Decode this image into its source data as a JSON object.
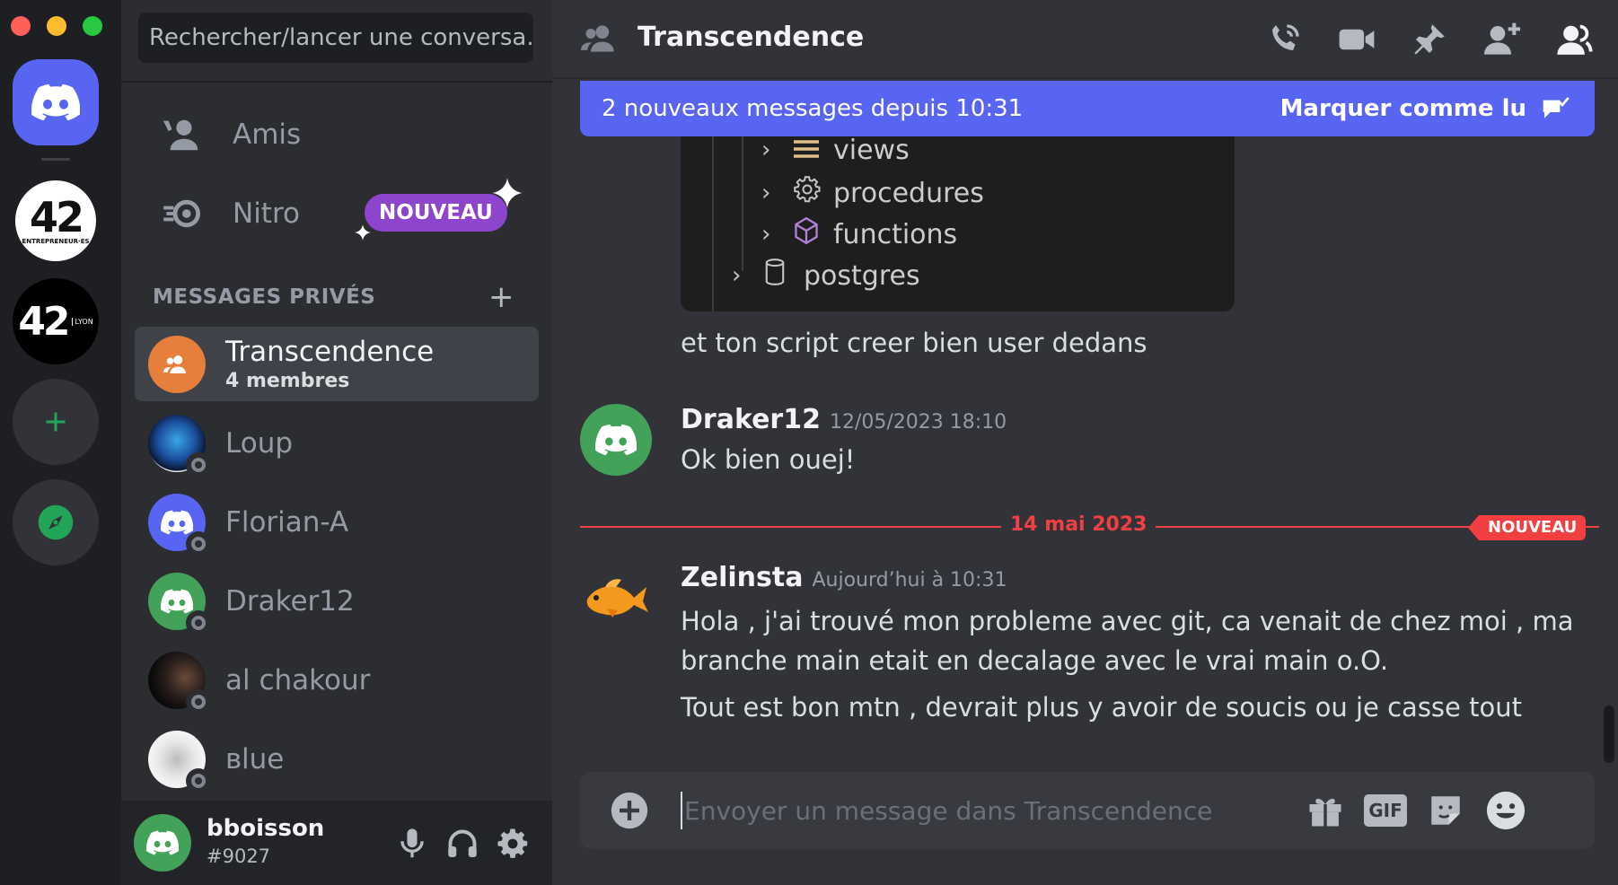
{
  "search": {
    "placeholder": "Rechercher/lancer une conversa..."
  },
  "nav": [
    {
      "label": "Amis",
      "icon": "friends-icon"
    },
    {
      "label": "Nitro",
      "icon": "nitro-icon",
      "badge": "NOUVEAU"
    }
  ],
  "dm_section": {
    "title": "MESSAGES PRIVÉS"
  },
  "dms": [
    {
      "name": "Transcendence",
      "subtitle": "4 membres",
      "active": true,
      "color": "#e67e3c"
    },
    {
      "name": "Loup",
      "status": "offline"
    },
    {
      "name": "Florian-A",
      "status": "offline",
      "color": "#5865f2"
    },
    {
      "name": "Draker12",
      "status": "offline",
      "color": "#43a25a"
    },
    {
      "name": "al chakour",
      "status": "offline"
    },
    {
      "name": "ʙlue",
      "status": "offline"
    }
  ],
  "user": {
    "name": "bboisson",
    "tag": "#9027",
    "color": "#43a25a"
  },
  "channel": {
    "title": "Transcendence"
  },
  "new_messages_bar": {
    "text": "2 nouveaux messages depuis 10:31",
    "action": "Marquer comme lu"
  },
  "attachment_tree": [
    {
      "label": "views",
      "icon": "views-icon"
    },
    {
      "label": "procedures",
      "icon": "gear-icon"
    },
    {
      "label": "functions",
      "icon": "cube-icon"
    },
    {
      "label": "postgres",
      "icon": "database-icon"
    }
  ],
  "messages": {
    "continuation": "et ton script creer bien user dedans",
    "m1": {
      "author": "Draker12",
      "time": "12/05/2023 18:10",
      "text": "Ok bien ouej!"
    },
    "divider": {
      "date": "14 mai 2023",
      "badge": "NOUVEAU"
    },
    "m2": {
      "author": "Zelinsta",
      "time": "Aujourd’hui à 10:31",
      "line1": "Hola , j'ai trouvé mon probleme avec git, ca venait de chez moi , ma",
      "line2": "branche main etait en decalage avec le vrai main o.O.",
      "line3": "Tout est bon mtn , devrait plus y avoir de soucis ou je casse tout"
    }
  },
  "composer": {
    "placeholder": "Envoyer un message dans Transcendence",
    "gif_label": "GIF"
  },
  "server_rail": {
    "server1_text": "42",
    "server1_sub": "ENTREPRENEUR·ES",
    "server2_text": "42",
    "server2_sub": "LYON"
  },
  "colors": {
    "blurple": "#5865f2",
    "green": "#43a25a",
    "red": "#f23f42",
    "nitro": "#8c45cc"
  }
}
